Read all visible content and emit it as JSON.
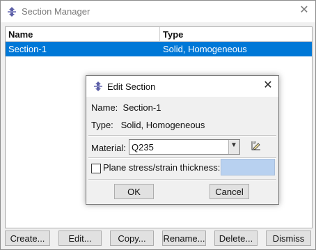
{
  "window": {
    "title": "Section Manager",
    "icon": "abaqus-section-icon",
    "close_glyph": "✕"
  },
  "table": {
    "columns": [
      "Name",
      "Type"
    ],
    "rows": [
      {
        "name": "Section-1",
        "type": "Solid, Homogeneous",
        "selected": true
      }
    ]
  },
  "buttons": {
    "create": "Create...",
    "edit": "Edit...",
    "copy": "Copy...",
    "rename": "Rename...",
    "delete": "Delete...",
    "dismiss": "Dismiss"
  },
  "dialog": {
    "title": "Edit Section",
    "close_glyph": "✕",
    "name_label": "Name:",
    "name_value": "Section-1",
    "type_label": "Type:",
    "type_value": "Solid, Homogeneous",
    "material_label": "Material:",
    "material_value": "Q235",
    "checkbox_label": "Plane stress/strain thickness:",
    "checkbox_checked": false,
    "thickness_value": "",
    "ok_label": "OK",
    "cancel_label": "Cancel"
  },
  "colors": {
    "selection": "#0078d7",
    "thickness_field": "#b8d1f0"
  }
}
